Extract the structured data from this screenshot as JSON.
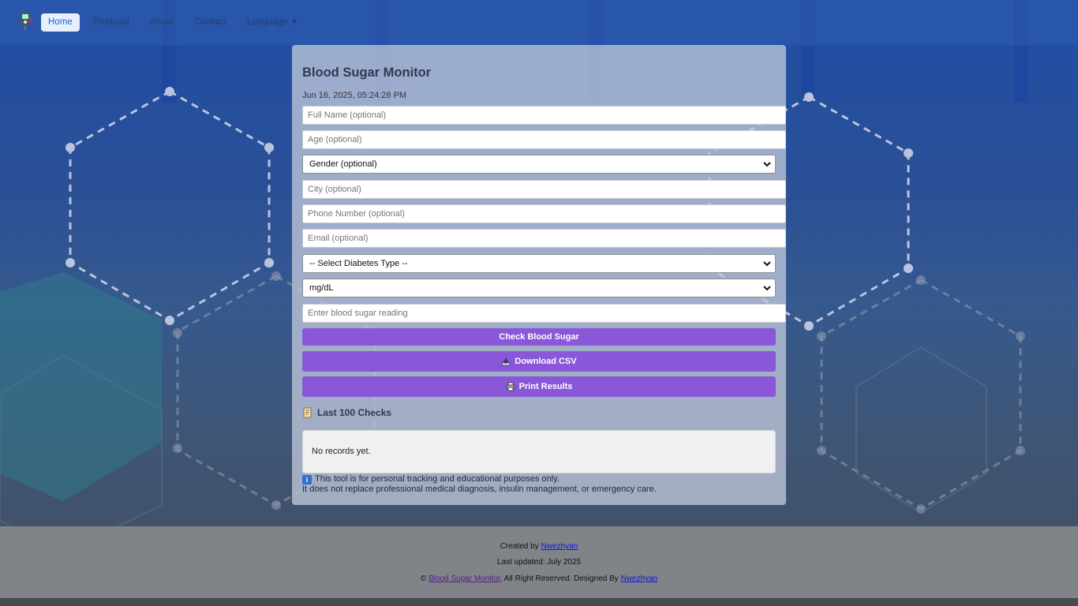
{
  "nav": {
    "items": [
      {
        "label": "Home",
        "active": true
      },
      {
        "label": "Producat"
      },
      {
        "label": "About"
      },
      {
        "label": "Contact"
      },
      {
        "label": "Language ▼"
      }
    ]
  },
  "monitor": {
    "title": "Blood Sugar Monitor",
    "datetime": "Jun 16, 2025, 05:24:28 PM",
    "fields": {
      "full_name_placeholder": "Full Name (optional)",
      "age_placeholder": "Age (optional)",
      "gender_selected": "Gender (optional)",
      "city_placeholder": "City (optional)",
      "phone_placeholder": "Phone Number (optional)",
      "email_placeholder": "Email (optional)",
      "diabetes_type_selected": "-- Select Diabetes Type --",
      "unit_selected": "mg/dL",
      "reading_placeholder": "Enter blood sugar reading"
    },
    "buttons": {
      "check": "Check Blood Sugar",
      "download": "Download CSV",
      "print": "Print Results"
    },
    "history": {
      "title": "Last 100 Checks",
      "empty_text": "No records yet."
    },
    "disclaimer": {
      "line1": "This tool is for personal tracking and educational purposes only.",
      "line2": "It does not replace professional medical diagnosis, insulin management, or emergency care."
    }
  },
  "footer": {
    "created_by_prefix": "Created by",
    "created_by_link": "Nwezhyan",
    "last_updated": "Last updated: July 2025",
    "copyright_symbol": "©",
    "site_link": "Blood Sugar Monitor",
    "rights_text": ", All Right Reserved. Designed By",
    "designer_link": "Nwezhyan"
  },
  "icons": {
    "logo": "glucose-meter-icon",
    "download": "download-tray-icon",
    "print": "printer-icon",
    "history": "scroll-icon",
    "info": "info-icon"
  },
  "colors": {
    "button": "#8a57d9",
    "nav_active_bg": "#e8f0fe",
    "nav_active_text": "#1f5fd6",
    "footer_bg": "#808488"
  }
}
